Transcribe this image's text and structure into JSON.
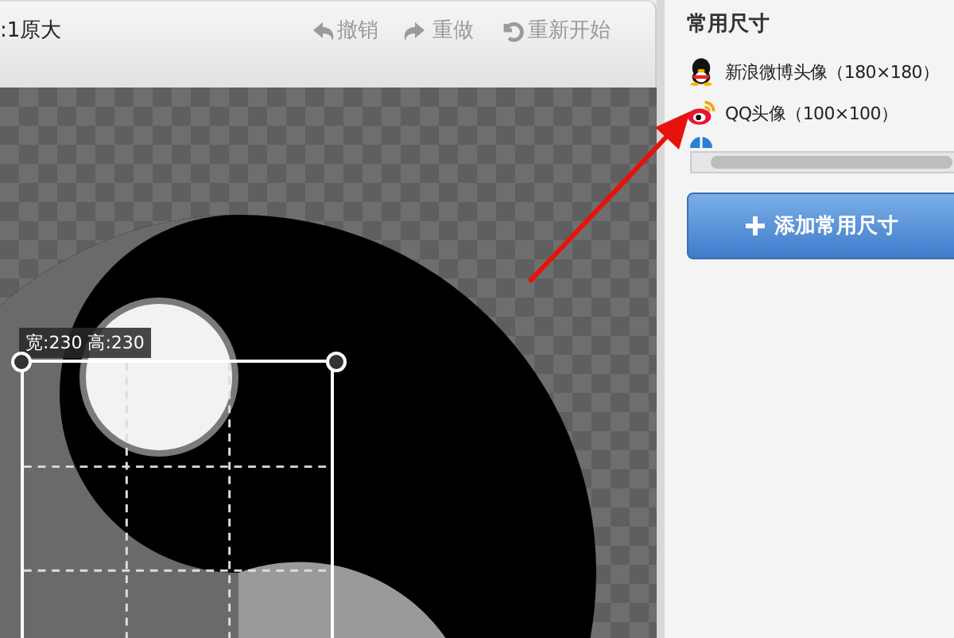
{
  "toolbar": {
    "zoom_label": ":1原大",
    "actions": [
      {
        "label": "撤销",
        "disabled": true
      },
      {
        "label": "重做",
        "disabled": true
      },
      {
        "label": "重新开始",
        "disabled": true
      }
    ]
  },
  "crop": {
    "size_label": "宽:230 高:230"
  },
  "sidebar": {
    "heading": "常用尺寸",
    "presets": [
      {
        "label": "新浪微博头像（180×180）"
      },
      {
        "label": "QQ头像（100×100）"
      }
    ],
    "add_button": "添加常用尺寸"
  }
}
